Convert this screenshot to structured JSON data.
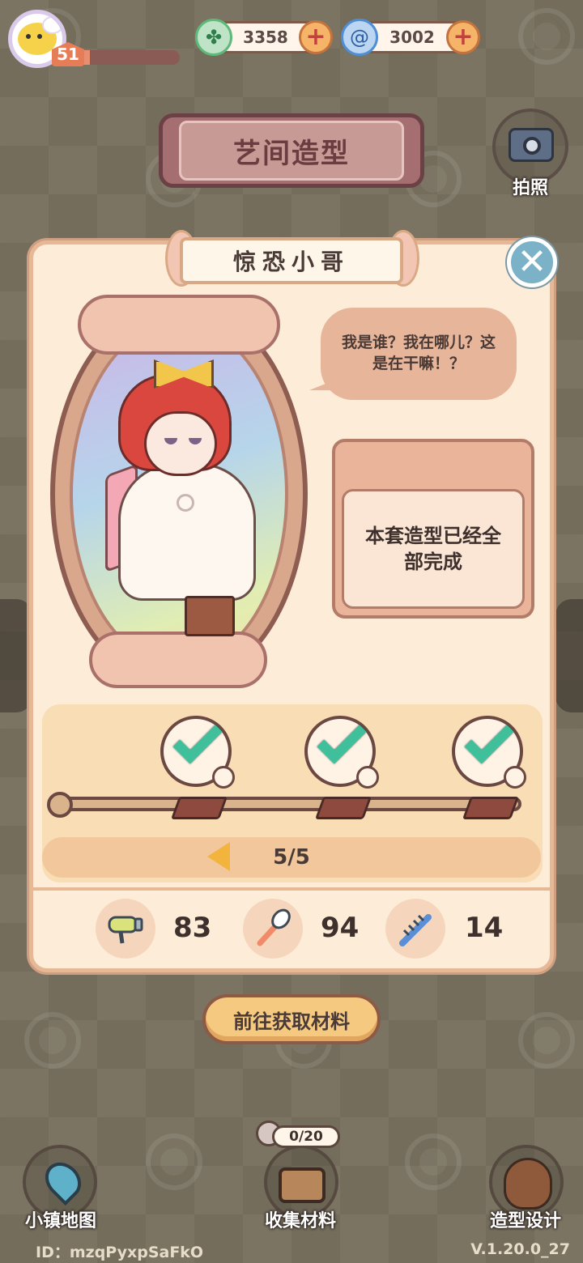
{
  "player": {
    "level": "51",
    "xp_progress": 0.12
  },
  "currencies": [
    {
      "name": "clover",
      "icon": "clover-icon",
      "amount": "3358",
      "color": "#5fb97a"
    },
    {
      "name": "swirl",
      "icon": "swirl-icon",
      "amount": "3002",
      "color": "#4f8fd6"
    }
  ],
  "header": {
    "title": "艺间造型",
    "camera_label": "拍照"
  },
  "card": {
    "character_name": "惊恐小哥",
    "speech": "我是谁？我在哪儿？这是在干嘛！？",
    "status_text": "本套造型已经全部完成",
    "steps_completed": [
      true,
      true,
      true
    ],
    "page": "5/5"
  },
  "materials": [
    {
      "icon": "hair-dryer-icon",
      "value": "83"
    },
    {
      "icon": "makeup-brush-icon",
      "value": "94"
    },
    {
      "icon": "comb-icon",
      "value": "14"
    }
  ],
  "actions": {
    "get_materials": "前往获取材料"
  },
  "nav": {
    "map": "小镇地图",
    "collect": "收集材料",
    "collect_counter": "0/20",
    "design": "造型设计"
  },
  "footer": {
    "id": "ID：mzqPyxpSaFkO",
    "version": "V.1.20.0_27"
  },
  "colors": {
    "accent": "#f6c980",
    "check": "#3fbf9a",
    "panel": "#fdecd8",
    "banner": "#a56f72"
  }
}
